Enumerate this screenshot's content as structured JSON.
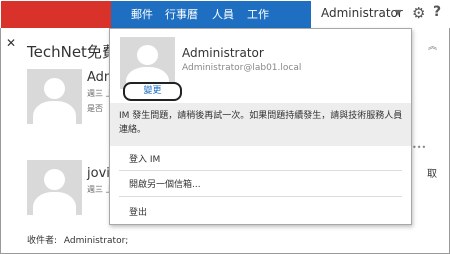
{
  "nav": {
    "items": [
      "郵件",
      "行事曆",
      "人員",
      "工作"
    ],
    "user": "Administrator"
  },
  "mail": {
    "folder_title": "TechNet免費技",
    "items": [
      {
        "sender": "Adm",
        "line1": "週三 上",
        "line2": "是否"
      },
      {
        "sender": "jovil",
        "line1": "週三 上"
      }
    ],
    "recipients_label": "收件者:",
    "recipients_value": "Administrator;"
  },
  "right_pane": {
    "item1": "取"
  },
  "profile": {
    "name": "Administrator",
    "email": "Administrator@lab01.local",
    "change_label": "變更",
    "im_message": "IM 發生問題，請稍後再試一次。如果問題持續發生，請與技術服務人員連絡。",
    "menu": [
      "登入 IM",
      "開啟另一個信箱...",
      "登出"
    ]
  },
  "colors": {
    "nav_red": "#d9322b",
    "nav_blue": "#1e6fc2",
    "link_blue": "#1e6fc2"
  }
}
